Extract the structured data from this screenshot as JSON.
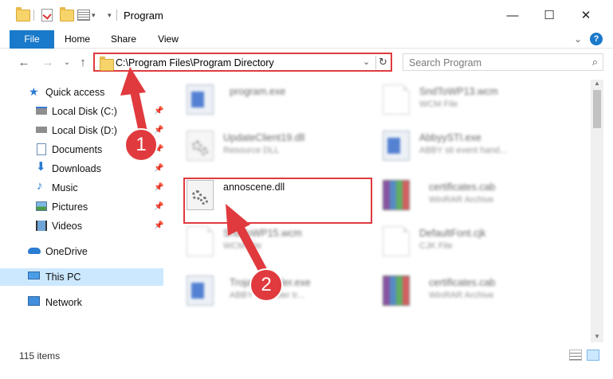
{
  "window": {
    "title": "Program",
    "minimize_glyph": "—",
    "maximize_glyph": "☐",
    "close_glyph": "✕"
  },
  "ribbon": {
    "tabs": [
      "File",
      "Home",
      "Share",
      "View"
    ],
    "collapse_glyph": "⌄",
    "help_glyph": "?"
  },
  "nav": {
    "back_glyph": "←",
    "forward_glyph": "→",
    "recent_glyph": "⌄",
    "up_glyph": "↑",
    "address": "C:\\Program Files\\Program Directory",
    "address_dropdown_glyph": "⌄",
    "refresh_glyph": "↻",
    "search_placeholder": "Search Program",
    "search_glyph": "⌕"
  },
  "sidebar": {
    "items": [
      {
        "label": "Quick access",
        "icon": "star-icon"
      },
      {
        "label": "Local Disk (C:)",
        "icon": "drive-icon",
        "pinned": true
      },
      {
        "label": "Local Disk (D:)",
        "icon": "drive-icon",
        "pinned": true
      },
      {
        "label": "Documents",
        "icon": "documents-icon",
        "pinned": true
      },
      {
        "label": "Downloads",
        "icon": "downloads-icon",
        "pinned": true
      },
      {
        "label": "Music",
        "icon": "music-icon",
        "pinned": true
      },
      {
        "label": "Pictures",
        "icon": "pictures-icon",
        "pinned": true
      },
      {
        "label": "Videos",
        "icon": "videos-icon",
        "pinned": true
      },
      {
        "label": "OneDrive",
        "icon": "cloud-icon"
      },
      {
        "label": "This PC",
        "icon": "computer-icon",
        "selected": true
      },
      {
        "label": "Network",
        "icon": "network-icon"
      }
    ],
    "pin_glyph": "📌"
  },
  "files": [
    {
      "name": "program.exe",
      "desc": "",
      "icon": "app-icon"
    },
    {
      "name": "SndToWP13.wcm",
      "desc": "WCM File",
      "icon": "document-icon"
    },
    {
      "name": "UpdateClient19.dll",
      "desc": "Resource DLL",
      "icon": "gear-file-icon"
    },
    {
      "name": "AbbyySTI.exe",
      "desc": "ABBY sti event hand...",
      "icon": "app-icon"
    },
    {
      "name": "annoscene.dll",
      "desc": "",
      "icon": "gear-file-icon"
    },
    {
      "name": "certificates.cab",
      "desc": "WinRAR Archive",
      "icon": "archive-icon"
    },
    {
      "name": "SndToWP15.wcm",
      "desc": "WCM File",
      "icon": "document-icon"
    },
    {
      "name": "DefaultFont.cjk",
      "desc": "CJK File",
      "icon": "document-icon"
    },
    {
      "name": "TrojanInstaller.exe",
      "desc": "ABBYY Reader tr...",
      "icon": "app-icon"
    },
    {
      "name": "certificates.cab",
      "desc": "WinRAR Archive",
      "icon": "archive-icon"
    }
  ],
  "annotations": {
    "step1": "1",
    "step2": "2"
  },
  "status": {
    "items_count": "115 items"
  },
  "colors": {
    "accent": "#1979ca",
    "highlight_red": "#e03a3e",
    "selected_bg": "#cce8ff"
  }
}
